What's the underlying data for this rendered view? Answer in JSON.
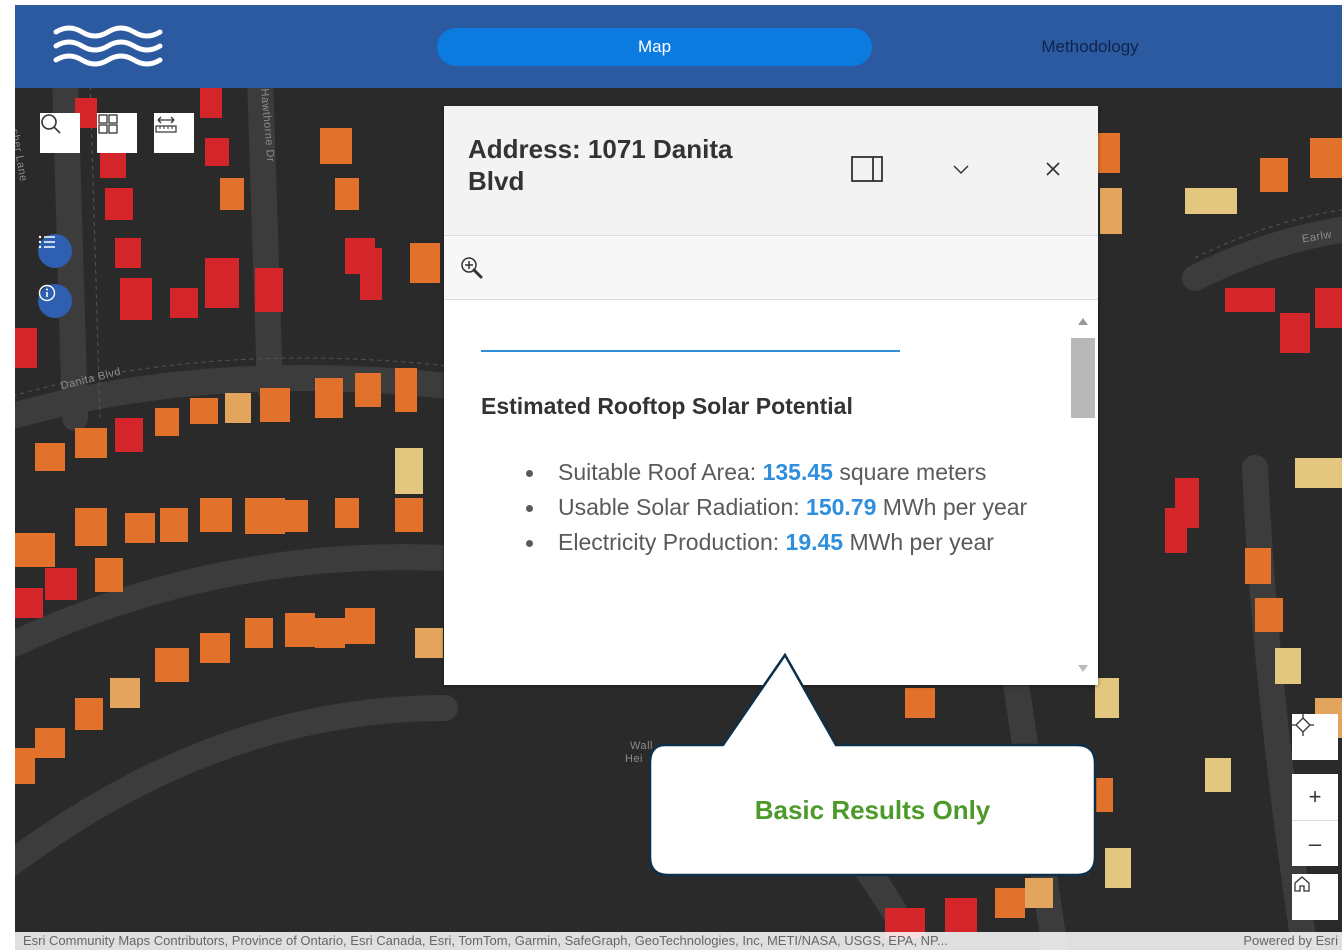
{
  "nav": {
    "tabs": [
      {
        "label": "Map",
        "active": true
      },
      {
        "label": "Methodology",
        "active": false
      }
    ]
  },
  "map": {
    "streets": [
      "Hawthorne Dr",
      "Danita Blvd",
      "Earlw",
      "Wall",
      "Hei"
    ],
    "top_left_label": "sher Lane"
  },
  "map_tools": {
    "icons": [
      "search-icon",
      "basemap-gallery-icon",
      "measure-icon",
      "layer-list-icon",
      "info-icon"
    ]
  },
  "popup": {
    "title": "Address: 1071 Danita Blvd",
    "section_title": "Estimated Rooftop Solar Potential",
    "results": [
      {
        "label": "Suitable Roof Area: ",
        "value": "135.45",
        "unit": " square meters"
      },
      {
        "label": "Usable Solar Radiation: ",
        "value": "150.79",
        "unit": " MWh per year"
      },
      {
        "label": "Electricity Production: ",
        "value": "19.45",
        "unit": " MWh per year"
      }
    ]
  },
  "callout": {
    "text": "Basic Results Only"
  },
  "zoom": {
    "plus": "+",
    "minus": "–"
  },
  "attribution": {
    "sources": "Esri Community Maps Contributors, Province of Ontario, Esri Canada, Esri, TomTom, Garmin, SafeGraph, GeoTechnologies, Inc, METI/NASA, USGS, EPA, NP...",
    "powered_by": "Powered by Esri"
  },
  "colors": {
    "header": "#2b5aa0",
    "active_tab": "#0b7be0",
    "value_blue": "#2f8fdc",
    "callout_green": "#4c9a2a",
    "map_bg": "#2a2a2a",
    "roof_red": "#d4262a",
    "roof_orange": "#e2712c",
    "roof_tan": "#e3c77e"
  }
}
